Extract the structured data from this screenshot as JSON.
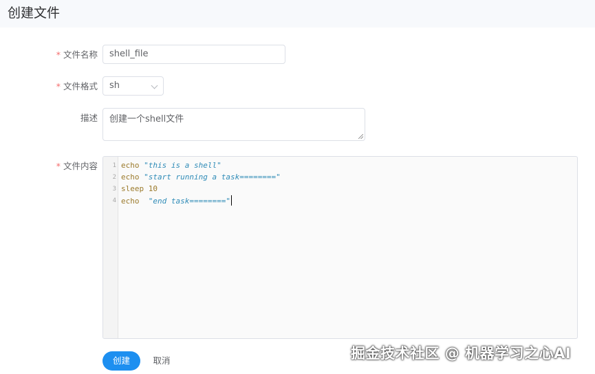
{
  "header": {
    "title": "创建文件"
  },
  "form": {
    "name": {
      "label": "文件名称",
      "required_mark": "*",
      "value": "shell_file"
    },
    "format": {
      "label": "文件格式",
      "required_mark": "*",
      "selected": "sh"
    },
    "description": {
      "label": "描述",
      "value": "创建一个shell文件"
    },
    "content": {
      "label": "文件内容",
      "required_mark": "*",
      "lines": [
        {
          "no": "1",
          "kw": "echo",
          "gap": " ",
          "str": "\"this is a shell\""
        },
        {
          "no": "2",
          "kw": "echo",
          "gap": " ",
          "str": "\"start running a task========\""
        },
        {
          "no": "3",
          "kw": "sleep",
          "gap": " ",
          "num": "10"
        },
        {
          "no": "4",
          "kw": "echo",
          "gap": "  ",
          "str": "\"end task========\""
        }
      ]
    }
  },
  "actions": {
    "create_label": "创建",
    "cancel_label": "取消"
  },
  "watermark": "掘金技术社区 @ 机器学习之心AI"
}
